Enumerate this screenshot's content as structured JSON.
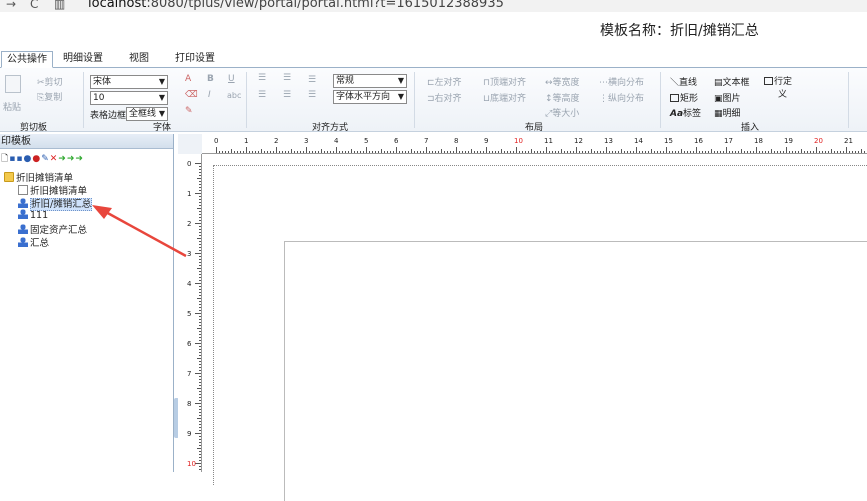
{
  "browser": {
    "back_label": "→",
    "reload_label": "C",
    "lock_label": "▥",
    "url_host": "localhost",
    "url_rest": ":8080/tplus/view/portal/portal.html?t=1615012388935"
  },
  "header": {
    "title": "模板名称：折旧/摊销汇总"
  },
  "tabs": [
    "公共操作",
    "明细设置",
    "视图",
    "打印设置"
  ],
  "ribbon": {
    "clipboard": {
      "paste": "粘贴",
      "cut": "剪切",
      "copy": "复制",
      "label": "剪切板"
    },
    "font": {
      "family": "宋体",
      "size": "10",
      "border_label": "表格边框",
      "border_value": "全框线",
      "bold": "B",
      "italic": "I",
      "underline": "U",
      "strike": "abc",
      "label": "字体"
    },
    "align": {
      "vertical": "常规",
      "horizontal": "字体水平方向",
      "label": "对齐方式"
    },
    "layout": {
      "left": "左对齐",
      "right": "右对齐",
      "top": "顶端对齐",
      "bottom": "底端对齐",
      "same_width": "等宽度",
      "same_height": "等高度",
      "same_size": "等大小",
      "h_distribute": "横向分布",
      "v_distribute": "纵向分布",
      "label": "布局"
    },
    "insert": {
      "line": "直线",
      "textbox": "文本框",
      "custom": "行定",
      "custom2": "义",
      "rect": "矩形",
      "image": "图片",
      "label_tool": "标签",
      "detail": "明细",
      "label": "插入"
    }
  },
  "left_panel": {
    "title": "印模板",
    "tree": [
      {
        "label": "折旧摊销清单",
        "type": "folder"
      },
      {
        "label": "折旧摊销清单",
        "type": "doc"
      },
      {
        "label": "折旧/摊销汇总",
        "type": "person",
        "selected": true
      },
      {
        "label": "111",
        "type": "person"
      },
      {
        "label": "固定资产汇总",
        "type": "person"
      },
      {
        "label": "汇总",
        "type": "person"
      }
    ]
  },
  "ruler": {
    "h_ticks": [
      "0",
      "1",
      "2",
      "3",
      "4",
      "5",
      "6",
      "7",
      "8",
      "9",
      "10",
      "11",
      "12",
      "13",
      "14",
      "15",
      "16",
      "17",
      "18",
      "19",
      "20",
      "21"
    ],
    "v_ticks": [
      "0",
      "1",
      "2",
      "3",
      "4",
      "5",
      "6",
      "7",
      "8",
      "9",
      "10"
    ]
  },
  "colors": {
    "accent": "#e02020",
    "tab_border": "#9bb1c8",
    "annotation_arrow": "#e8463c"
  }
}
